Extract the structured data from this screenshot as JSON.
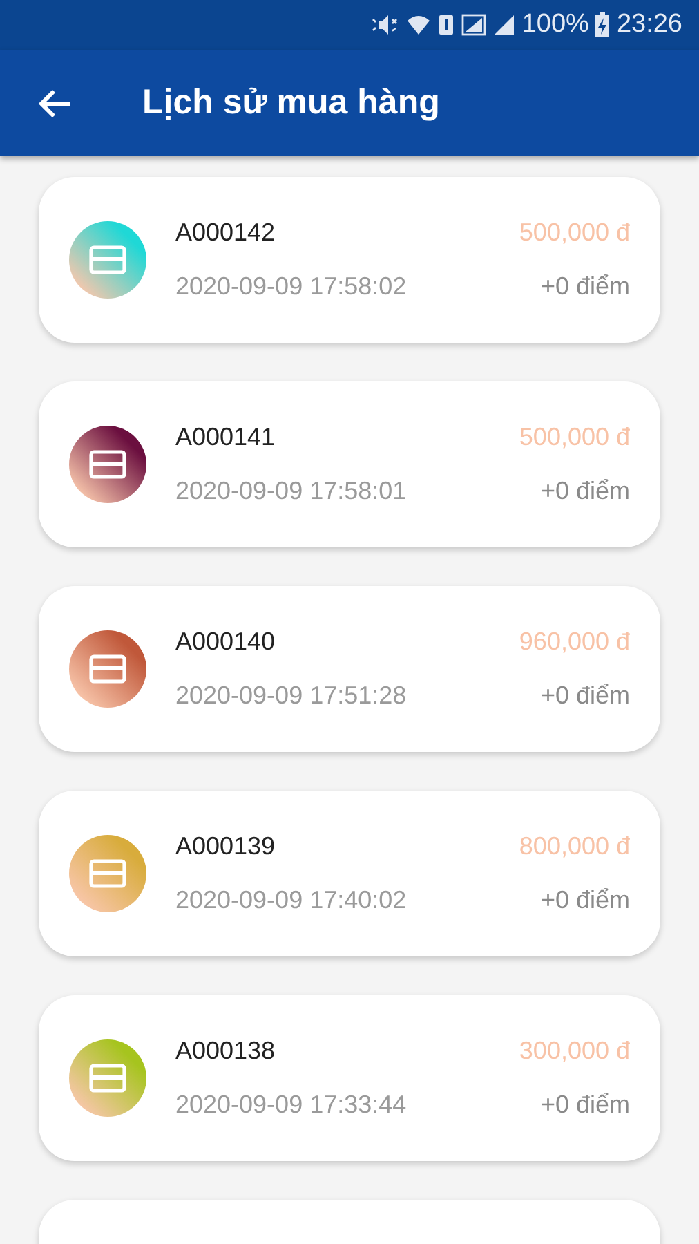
{
  "status_bar": {
    "battery": "100%",
    "time": "23:26"
  },
  "app_bar": {
    "title": "Lịch sử mua hàng"
  },
  "orders": [
    {
      "code": "A000142",
      "datetime": "2020-09-09 17:58:02",
      "amount": "500,000 đ",
      "points": "+0 điểm",
      "color": "#1fd8d6"
    },
    {
      "code": "A000141",
      "datetime": "2020-09-09 17:58:01",
      "amount": "500,000 đ",
      "points": "+0 điểm",
      "color": "#6b0f3f"
    },
    {
      "code": "A000140",
      "datetime": "2020-09-09 17:51:28",
      "amount": "960,000 đ",
      "points": "+0 điểm",
      "color": "#c0583a"
    },
    {
      "code": "A000139",
      "datetime": "2020-09-09 17:40:02",
      "amount": "800,000 đ",
      "points": "+0 điểm",
      "color": "#d8ac3c"
    },
    {
      "code": "A000138",
      "datetime": "2020-09-09 17:33:44",
      "amount": "300,000 đ",
      "points": "+0 điểm",
      "color": "#a6c41e"
    }
  ]
}
